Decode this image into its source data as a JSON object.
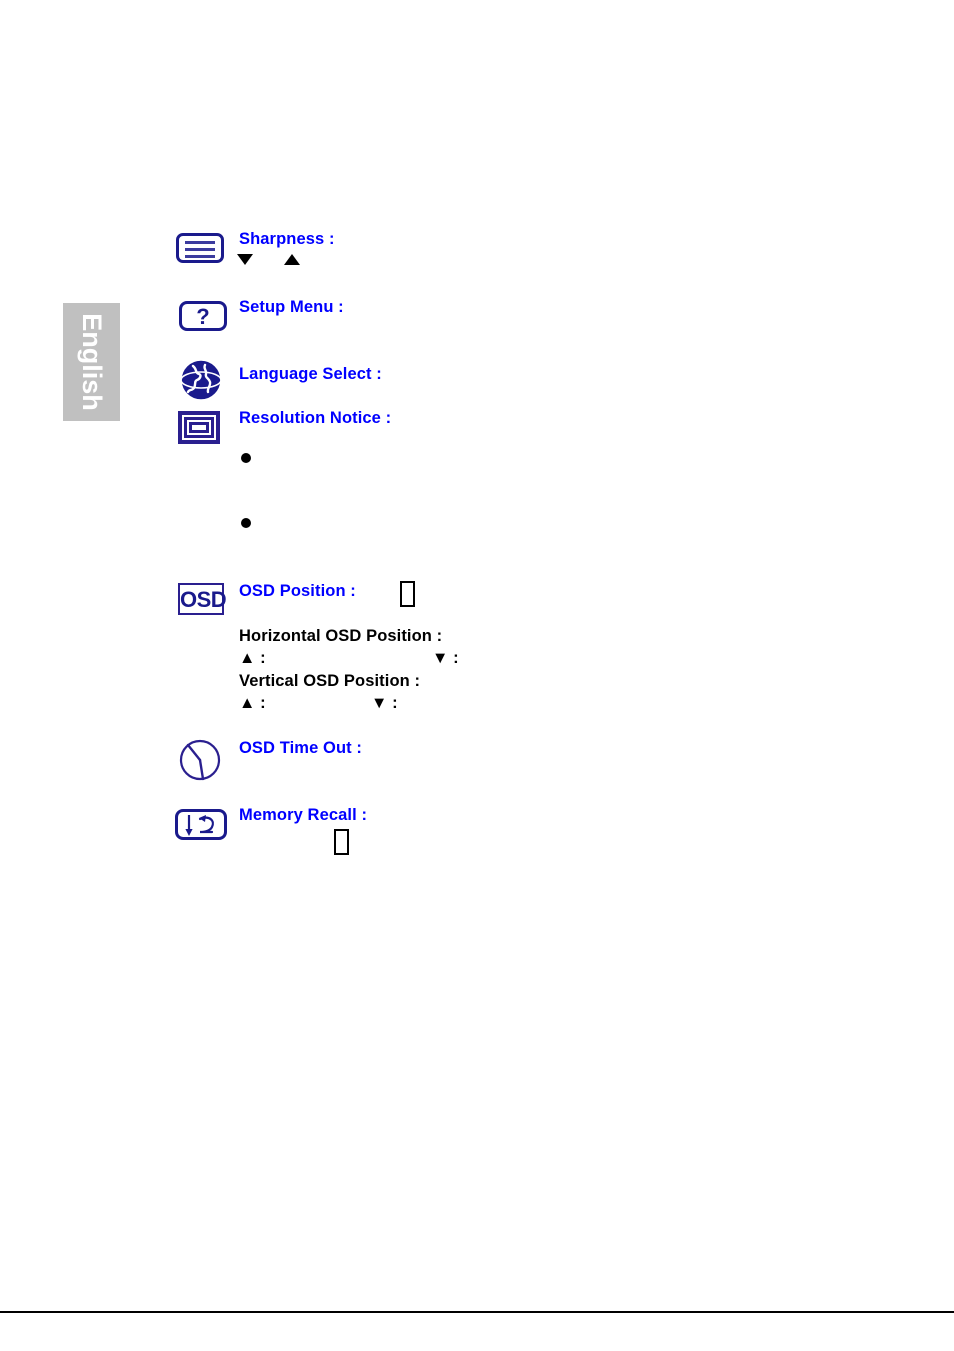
{
  "page": {
    "language_tab": "English",
    "background_color": "#ffffff",
    "tab_color": "#c0c0c0",
    "heading_color": "#0000ff",
    "subheading_color": "#000000",
    "icon_color": "#1a1a8c"
  },
  "entries": [
    {
      "icon": "sharpness-lines-icon",
      "label": "Sharpness :",
      "sub_glyphs": [
        "▼",
        "▲"
      ]
    },
    {
      "icon": "question-mark-icon",
      "label": "Setup Menu :"
    },
    {
      "icon": "globe-icon",
      "label": "Language Select :"
    },
    {
      "icon": "monitor-frame-icon",
      "label": "Resolution Notice :",
      "bullets": [
        "",
        ""
      ]
    },
    {
      "icon": "osd-text-icon",
      "label": "OSD Position :",
      "trailing_glyph": "□"
    },
    {
      "icon": "clock-icon",
      "label": "OSD Time Out :"
    },
    {
      "icon": "memory-recall-icon",
      "label": "Memory Recall :",
      "trailing_glyph": "□"
    }
  ],
  "osd_position_details": {
    "horizontal_label": "Horizontal OSD Position :",
    "horizontal_up": "▲ :",
    "horizontal_down": "▼ :",
    "vertical_label": "Vertical OSD Position :",
    "vertical_up": "▲ :",
    "vertical_down": "▼ :"
  }
}
